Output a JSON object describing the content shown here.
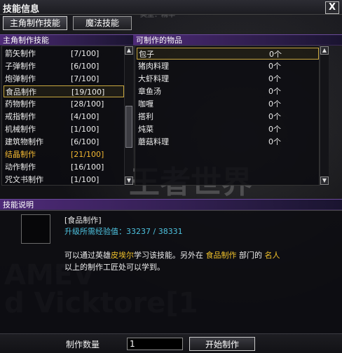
{
  "window": {
    "title": "技能信息",
    "close_label": "X"
  },
  "tabs": [
    {
      "label": "主角制作技能",
      "active": true
    },
    {
      "label": "魔法技能",
      "active": false
    }
  ],
  "skills_panel": {
    "header": "主角制作技能",
    "items": [
      {
        "name": "箭矢制作",
        "level": "[7/100]"
      },
      {
        "name": "子弹制作",
        "level": "[6/100]"
      },
      {
        "name": "炮弹制作",
        "level": "[7/100]"
      },
      {
        "name": "食品制作",
        "level": "[19/100]",
        "selected": true
      },
      {
        "name": "药物制作",
        "level": "[28/100]"
      },
      {
        "name": "戒指制作",
        "level": "[4/100]"
      },
      {
        "name": "机械制作",
        "level": "[1/100]"
      },
      {
        "name": "建筑物制作",
        "level": "[6/100]"
      },
      {
        "name": "结晶制作",
        "level": "[21/100]",
        "highlight": true
      },
      {
        "name": "动作制作",
        "level": "[16/100]"
      },
      {
        "name": "咒文书制作",
        "level": "[1/100]"
      }
    ]
  },
  "items_panel": {
    "header": "可制作的物品",
    "items": [
      {
        "name": "包子",
        "count": "0个",
        "selected": true
      },
      {
        "name": "猪肉料理",
        "count": "0个"
      },
      {
        "name": "大虾料理",
        "count": "0个"
      },
      {
        "name": "章鱼汤",
        "count": "0个"
      },
      {
        "name": "咖喱",
        "count": "0个"
      },
      {
        "name": "搭利",
        "count": "0个"
      },
      {
        "name": "炖菜",
        "count": "0个"
      },
      {
        "name": "蘑菇料理",
        "count": "0个"
      }
    ]
  },
  "description": {
    "header": "技能说明",
    "skill_name": "[食品制作]",
    "exp_line": "升级所需经验值：33237 / 38331",
    "text1_a": "可以通过英雄",
    "text1_b": "皮埃尔",
    "text1_c": "学习该技能。另外在",
    "text1_d": "食品制作",
    "text1_e": "部门的",
    "text1_f": "名人",
    "text2": "以上的制作工匠处可以学到。"
  },
  "bottom": {
    "qty_label": "制作数量",
    "qty_value": "1",
    "start_label": "开始制作"
  },
  "colors": {
    "section_header": "#4e2a78",
    "highlight_text": "#f3b832",
    "selection_border": "#c9a840",
    "exp_text": "#4ec3e0"
  }
}
